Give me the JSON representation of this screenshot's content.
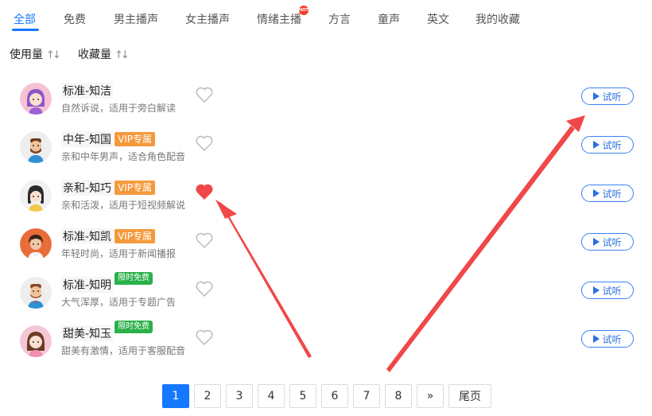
{
  "tabs": [
    {
      "label": "全部",
      "active": true
    },
    {
      "label": "免费"
    },
    {
      "label": "男主播声"
    },
    {
      "label": "女主播声"
    },
    {
      "label": "情绪主播",
      "badge": "HOT"
    },
    {
      "label": "方言"
    },
    {
      "label": "童声"
    },
    {
      "label": "英文"
    },
    {
      "label": "我的收藏"
    }
  ],
  "sort": {
    "usage_label": "使用量",
    "favorites_label": "收藏量",
    "arrow_glyph": "↑↓"
  },
  "voices": [
    {
      "name": "标准-知洁",
      "badge": "",
      "desc": "自然诉说，适用于旁白解读",
      "favorited": false,
      "listen_label": "试听"
    },
    {
      "name": "中年-知国",
      "badge": "VIP专属",
      "desc": "亲和中年男声，适合角色配音",
      "favorited": false,
      "listen_label": "试听"
    },
    {
      "name": "亲和-知巧",
      "badge": "VIP专属",
      "desc": "亲和活泼，适用于短视频解说",
      "favorited": true,
      "listen_label": "试听"
    },
    {
      "name": "标准-知凯",
      "badge": "VIP专属",
      "desc": "年轻时尚，适用于新闻播报",
      "favorited": false,
      "listen_label": "试听"
    },
    {
      "name": "标准-知明",
      "badge": "限时免费",
      "desc": "大气浑厚，适用于专题广告",
      "favorited": false,
      "listen_label": "试听"
    },
    {
      "name": "甜美-知玉",
      "badge": "限时免费",
      "desc": "甜美有激情，适用于客服配音",
      "favorited": false,
      "listen_label": "试听"
    }
  ],
  "pagination": {
    "pages": [
      "1",
      "2",
      "3",
      "4",
      "5",
      "6",
      "7",
      "8"
    ],
    "current": "1",
    "next_label": "»",
    "last_label": "尾页"
  },
  "colors": {
    "accent": "#1677ff",
    "vip": "#f59a3c",
    "free": "#2bb14a",
    "heart_active": "#f04848",
    "annotation_arrow": "#f04848"
  },
  "icons": {
    "heart": "heart-icon",
    "play": "play-icon",
    "sort": "sort-arrows-icon"
  }
}
